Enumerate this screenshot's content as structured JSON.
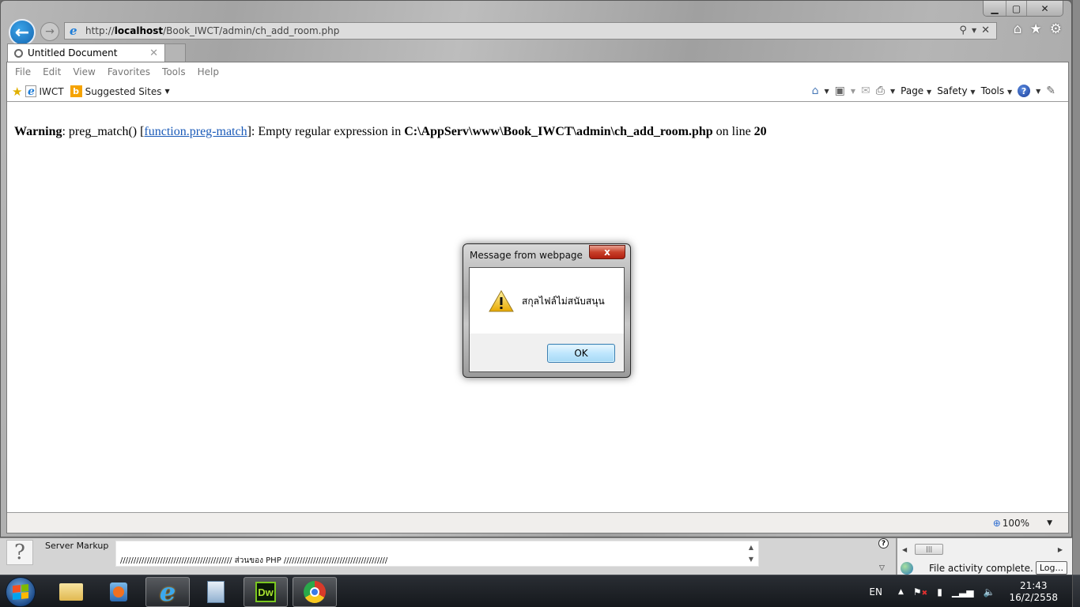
{
  "browser": {
    "url_prefix": "http://",
    "url_host": "localhost",
    "url_path": "/Book_IWCT/admin/ch_add_room.php",
    "tab_title": "Untitled Document",
    "caption": {
      "minimize": "▁",
      "maximize": "▢",
      "close": "✕"
    },
    "menu": [
      "File",
      "Edit",
      "View",
      "Favorites",
      "Tools",
      "Help"
    ],
    "favorites": [
      {
        "label": "IWCT",
        "icon": "ie-page-icon"
      },
      {
        "label": "Suggested Sites",
        "icon": "bing-icon"
      }
    ],
    "command_bar": {
      "page": "Page",
      "safety": "Safety",
      "tools": "Tools"
    },
    "zoom_level": "100%"
  },
  "page": {
    "warning_label": "Warning",
    "warning_text_1": ": preg_match() [",
    "warning_link": "function.preg-match",
    "warning_text_2": "]: Empty regular expression in ",
    "warning_file": "C:\\AppServ\\www\\Book_IWCT\\admin\\ch_add_room.php",
    "warning_text_3": " on line ",
    "warning_line": "20"
  },
  "dialog": {
    "title": "Message from webpage",
    "message": "สกุลไฟล์ไม่สนับสนุน",
    "ok_label": "OK",
    "close_glyph": "x"
  },
  "dreamweaver": {
    "help_glyph": "?",
    "server_markup_label": "Server Markup",
    "code_line": "////////////////////////////////////////// ส่วนของ PHP ///////////////////////////////////////",
    "files_status": "File activity complete.",
    "log_button": "Log..."
  },
  "taskbar": {
    "language": "EN",
    "time": "21:43",
    "date": "16/2/2558",
    "apps": [
      "Windows Explorer",
      "Windows Media Player",
      "Internet Explorer",
      "Calculator",
      "Dreamweaver",
      "Google Chrome"
    ],
    "dw_label": "Dw"
  }
}
